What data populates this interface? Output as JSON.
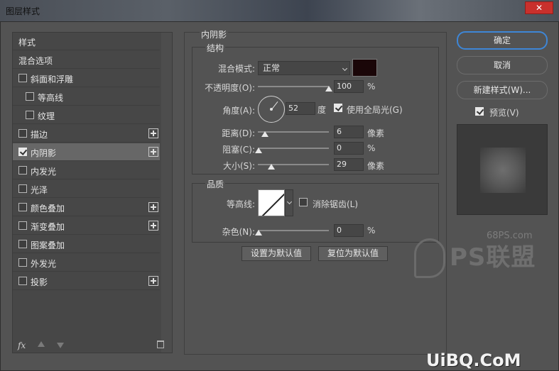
{
  "window": {
    "title": "图层样式"
  },
  "style_list": {
    "header": "样式",
    "items": [
      {
        "label": "混合选项",
        "checkbox": false,
        "checked": false,
        "plus": false,
        "indent": 0
      },
      {
        "label": "斜面和浮雕",
        "checkbox": true,
        "checked": false,
        "plus": false,
        "indent": 0
      },
      {
        "label": "等高线",
        "checkbox": true,
        "checked": false,
        "plus": false,
        "indent": 1
      },
      {
        "label": "纹理",
        "checkbox": true,
        "checked": false,
        "plus": false,
        "indent": 1
      },
      {
        "label": "描边",
        "checkbox": true,
        "checked": false,
        "plus": true,
        "indent": 0
      },
      {
        "label": "内阴影",
        "checkbox": true,
        "checked": true,
        "plus": true,
        "indent": 0,
        "active": true
      },
      {
        "label": "内发光",
        "checkbox": true,
        "checked": false,
        "plus": false,
        "indent": 0
      },
      {
        "label": "光泽",
        "checkbox": true,
        "checked": false,
        "plus": false,
        "indent": 0
      },
      {
        "label": "颜色叠加",
        "checkbox": true,
        "checked": false,
        "plus": true,
        "indent": 0
      },
      {
        "label": "渐变叠加",
        "checkbox": true,
        "checked": false,
        "plus": true,
        "indent": 0
      },
      {
        "label": "图案叠加",
        "checkbox": true,
        "checked": false,
        "plus": false,
        "indent": 0
      },
      {
        "label": "外发光",
        "checkbox": true,
        "checked": false,
        "plus": false,
        "indent": 0
      },
      {
        "label": "投影",
        "checkbox": true,
        "checked": false,
        "plus": true,
        "indent": 0
      }
    ],
    "fx_label": "fx"
  },
  "inner_shadow": {
    "section_title": "内阴影",
    "structure": {
      "title": "结构",
      "blend_mode_label": "混合模式:",
      "blend_mode_value": "正常",
      "shadow_color": "#1a0608",
      "opacity_label": "不透明度(O):",
      "opacity_value": "100",
      "opacity_unit": "%",
      "angle_label": "角度(A):",
      "angle_value": "52",
      "angle_unit": "度",
      "global_light_label": "使用全局光(G)",
      "global_light_checked": true,
      "distance_label": "距离(D):",
      "distance_value": "6",
      "distance_unit": "像素",
      "choke_label": "阻塞(C):",
      "choke_value": "0",
      "choke_unit": "%",
      "size_label": "大小(S):",
      "size_value": "29",
      "size_unit": "像素"
    },
    "quality": {
      "title": "品质",
      "contour_label": "等高线:",
      "antialias_label": "消除锯齿(L)",
      "antialias_checked": false,
      "noise_label": "杂色(N):",
      "noise_value": "0",
      "noise_unit": "%"
    },
    "set_default_label": "设置为默认值",
    "reset_default_label": "复位为默认值"
  },
  "actions": {
    "ok_label": "确定",
    "cancel_label": "取消",
    "new_style_label": "新建样式(W)...",
    "preview_label": "预览(V)",
    "preview_checked": true
  },
  "watermarks": {
    "site": "68PS.com",
    "logo_text": "PS联盟",
    "footer": "UiBQ.CoM"
  }
}
